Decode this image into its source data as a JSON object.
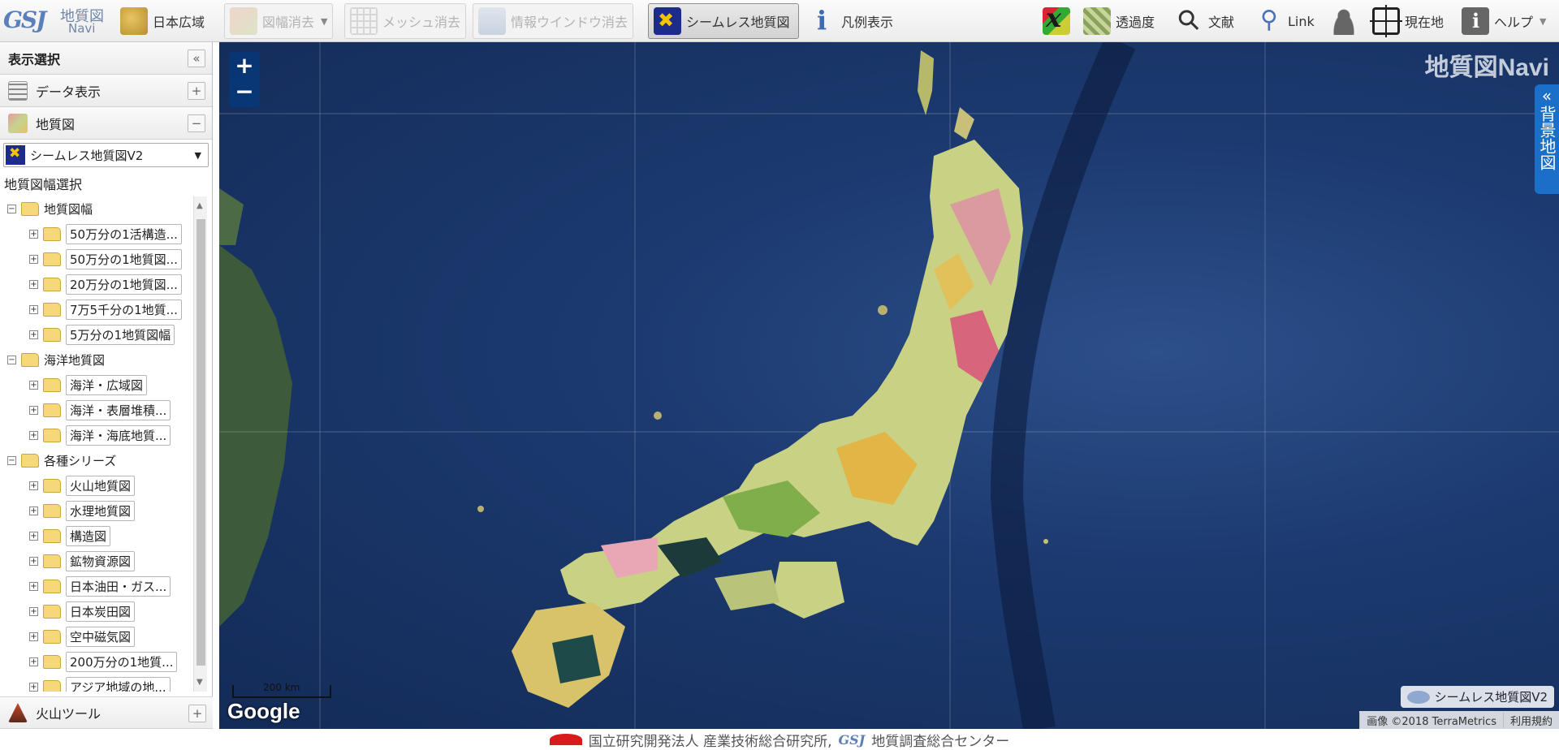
{
  "app": {
    "logo_line1": "地質図",
    "logo_line2": "Navi",
    "logo_mark": "GSJ"
  },
  "toolbar": {
    "japan": "日本広域",
    "erase_sheet": "図幅消去",
    "mesh_erase": "メッシュ消去",
    "info_erase": "情報ウインドウ消去",
    "seamless": "シームレス地質図",
    "legend": "凡例表示",
    "transparency": "透過度",
    "literature": "文献",
    "link": "Link",
    "location": "現在地",
    "help": "ヘルプ"
  },
  "side": {
    "header": "表示選択",
    "data_display": "データ表示",
    "geology": "地質図",
    "selected_map": "シームレス地質図V2",
    "sheet_select": "地質図幅選択",
    "volcano_tools": "火山ツール",
    "tree": [
      {
        "level": 0,
        "label": "地質図幅",
        "boxed": false
      },
      {
        "level": 1,
        "label": "50万分の1活構造...",
        "boxed": true
      },
      {
        "level": 1,
        "label": "50万分の1地質図...",
        "boxed": true
      },
      {
        "level": 1,
        "label": "20万分の1地質図...",
        "boxed": true
      },
      {
        "level": 1,
        "label": "7万5千分の1地質...",
        "boxed": true
      },
      {
        "level": 1,
        "label": "5万分の1地質図幅",
        "boxed": true
      },
      {
        "level": 0,
        "label": "海洋地質図",
        "boxed": false
      },
      {
        "level": 1,
        "label": "海洋・広域図",
        "boxed": true
      },
      {
        "level": 1,
        "label": "海洋・表層堆積...",
        "boxed": true
      },
      {
        "level": 1,
        "label": "海洋・海底地質...",
        "boxed": true
      },
      {
        "level": 0,
        "label": "各種シリーズ",
        "boxed": false
      },
      {
        "level": 1,
        "label": "火山地質図",
        "boxed": true
      },
      {
        "level": 1,
        "label": "水理地質図",
        "boxed": true
      },
      {
        "level": 1,
        "label": "構造図",
        "boxed": true
      },
      {
        "level": 1,
        "label": "鉱物資源図",
        "boxed": true
      },
      {
        "level": 1,
        "label": "日本油田・ガス...",
        "boxed": true
      },
      {
        "level": 1,
        "label": "日本炭田図",
        "boxed": true
      },
      {
        "level": 1,
        "label": "空中磁気図",
        "boxed": true
      },
      {
        "level": 1,
        "label": "200万分の1地質...",
        "boxed": true
      },
      {
        "level": 1,
        "label": "アジア地域の地...",
        "boxed": true
      }
    ]
  },
  "map": {
    "watermark": "地質図Navi",
    "background_tab": "背景地図",
    "zoom_in": "+",
    "zoom_out": "−",
    "scale": "200 km",
    "google": "Google",
    "layer_badge": "シームレス地質図V2",
    "attribution": "画像 ©2018 TerraMetrics",
    "terms": "利用規約"
  },
  "footer": {
    "org1": "国立研究開発法人 産業技術総合研究所,",
    "org2": "地質調査総合センター"
  },
  "colors": {
    "accent": "#1c6fc9",
    "ocean": "#1c3a70",
    "seamless_icon": "#1d2b8a"
  }
}
